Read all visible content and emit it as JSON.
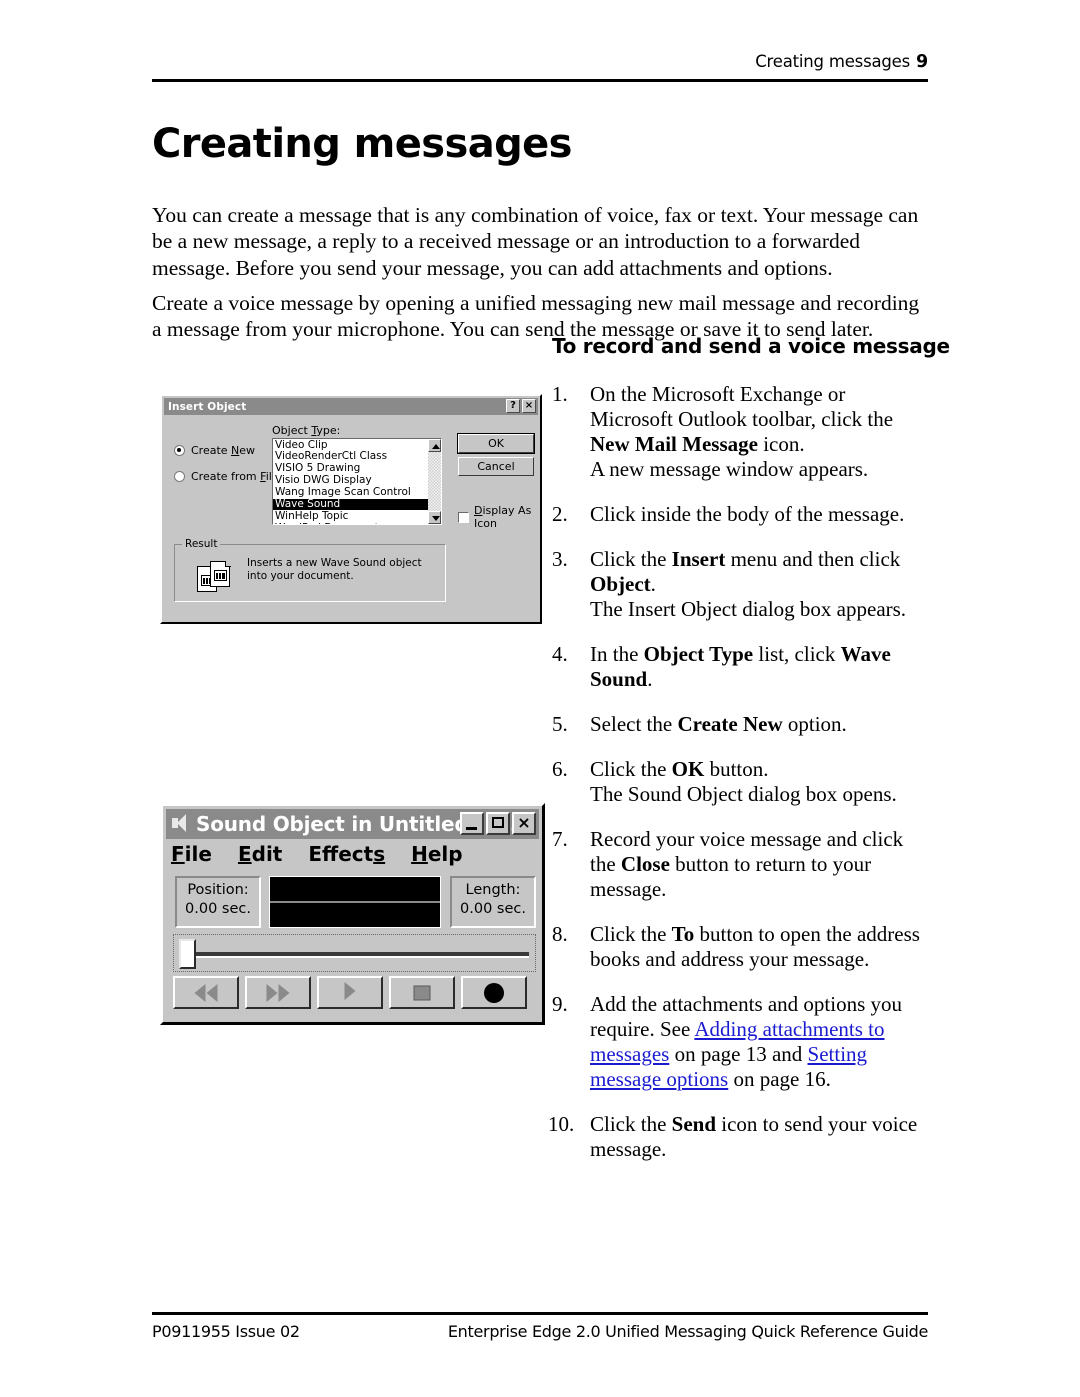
{
  "header": {
    "running_head": "Creating messages",
    "page_number": "9"
  },
  "title": "Creating messages",
  "intro_paragraphs": [
    "You can create a message that is any combination of voice, fax or text. Your message can be a new message, a reply to a received message or an introduction to a forwarded message. Before you send your message, you can add attachments and options.",
    "Create a voice message by opening a unified messaging new mail message and recording a message from your microphone. You can send the message or save it to send later."
  ],
  "procedure": {
    "heading": "To record and send a voice message",
    "steps": [
      {
        "number": "1.",
        "parts": [
          {
            "t": "On the Microsoft Exchange or Microsoft Outlook toolbar, click the ",
            "b": false
          },
          {
            "t": "New Mail Message",
            "b": true
          },
          {
            "t": " icon.",
            "b": false
          }
        ],
        "sub": "A new message window appears."
      },
      {
        "number": "2.",
        "parts": [
          {
            "t": "Click inside the body of the message.",
            "b": false
          }
        ],
        "sub": ""
      },
      {
        "number": "3.",
        "parts": [
          {
            "t": "Click the ",
            "b": false
          },
          {
            "t": "Insert",
            "b": true
          },
          {
            "t": " menu and then click ",
            "b": false
          },
          {
            "t": "Object",
            "b": true
          },
          {
            "t": ".",
            "b": false
          }
        ],
        "sub": "The Insert Object dialog box appears."
      },
      {
        "number": "4.",
        "parts": [
          {
            "t": "In the ",
            "b": false
          },
          {
            "t": "Object Type",
            "b": true
          },
          {
            "t": " list, click ",
            "b": false
          },
          {
            "t": "Wave Sound",
            "b": true
          },
          {
            "t": ".",
            "b": false
          }
        ],
        "sub": ""
      },
      {
        "number": "5.",
        "parts": [
          {
            "t": "Select the ",
            "b": false
          },
          {
            "t": "Create New",
            "b": true
          },
          {
            "t": " option.",
            "b": false
          }
        ],
        "sub": ""
      },
      {
        "number": "6.",
        "parts": [
          {
            "t": "Click the ",
            "b": false
          },
          {
            "t": "OK",
            "b": true
          },
          {
            "t": " button.",
            "b": false
          }
        ],
        "sub": "The Sound Object dialog box opens."
      },
      {
        "number": "7.",
        "parts": [
          {
            "t": "Record your voice message and click the ",
            "b": false
          },
          {
            "t": "Close",
            "b": true
          },
          {
            "t": " button to return to your message.",
            "b": false
          }
        ],
        "sub": ""
      },
      {
        "number": "8.",
        "parts": [
          {
            "t": "Click the ",
            "b": false
          },
          {
            "t": "To",
            "b": true
          },
          {
            "t": " button to open the address books and address your message.",
            "b": false
          }
        ],
        "sub": ""
      },
      {
        "number": "9.",
        "parts": [
          {
            "t": "Add the attachments and options you require. See ",
            "b": false
          },
          {
            "t": "Adding attachments to messages",
            "b": false,
            "link": true
          },
          {
            "t": " on page 13 and ",
            "b": false
          },
          {
            "t": "Setting message options",
            "b": false,
            "link": true
          },
          {
            "t": " on page 16.",
            "b": false
          }
        ],
        "sub": ""
      },
      {
        "number": "10.",
        "parts": [
          {
            "t": "Click the ",
            "b": false
          },
          {
            "t": "Send",
            "b": true
          },
          {
            "t": " icon to send your voice message.",
            "b": false
          }
        ],
        "sub": ""
      }
    ]
  },
  "insert_object_dialog": {
    "title": "Insert Object",
    "help_button": "?",
    "close_button": "×",
    "object_type_label": "Object Type:",
    "radio_create_new": "Create New",
    "radio_create_from_file": "Create from File",
    "radio_selected": "Create New",
    "object_types": [
      "Video Clip",
      "VideoRenderCtl Class",
      "VISIO 5 Drawing",
      "Visio DWG Display",
      "Wang Image Scan Control",
      "Wave Sound",
      "WinHelp Topic",
      "WordPad Document"
    ],
    "selected_object_type": "Wave Sound",
    "ok_label": "OK",
    "cancel_label": "Cancel",
    "display_as_icon_label": "Display As Icon",
    "display_as_icon_checked": false,
    "result_group_label": "Result",
    "result_text": "Inserts a new Wave Sound object into your document."
  },
  "sound_object_dialog": {
    "title": "Sound Object in Untitled - M...",
    "minimize_label": "_",
    "maximize_label": "□",
    "close_label": "×",
    "menus": [
      "File",
      "Edit",
      "Effects",
      "Help"
    ],
    "position_label": "Position:",
    "position_value": "0.00 sec.",
    "length_label": "Length:",
    "length_value": "0.00 sec.",
    "transport_buttons": [
      "rewind",
      "forward",
      "play",
      "stop",
      "record"
    ]
  },
  "footer": {
    "left": "P0911955 Issue 02",
    "right": "Enterprise Edge 2.0 Unified Messaging Quick Reference Guide"
  },
  "colors": {
    "link": "#1a1ad0",
    "dialog_face": "#c6c6c6",
    "titlebar": "#8a8a8a"
  }
}
